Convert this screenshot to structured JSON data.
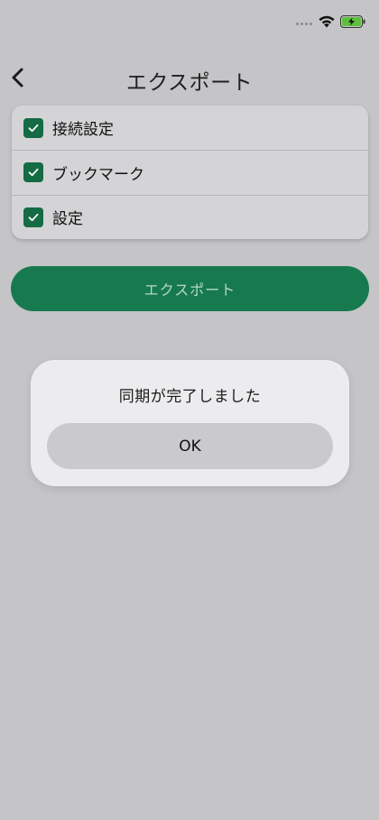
{
  "status_bar": {
    "signal_icon": "cellular-dots-icon",
    "wifi_icon": "wifi-icon",
    "battery_icon": "battery-charging-icon",
    "battery_accent": "#5ec03c"
  },
  "header": {
    "back_icon": "chevron-left-icon",
    "title": "エクスポート"
  },
  "options": [
    {
      "label": "接続設定",
      "checked": true
    },
    {
      "label": "ブックマーク",
      "checked": true
    },
    {
      "label": "設定",
      "checked": true
    }
  ],
  "export_button": {
    "label": "エクスポート"
  },
  "dialog": {
    "message": "同期が完了しました",
    "ok_label": "OK"
  },
  "colors": {
    "accent": "#177a4e",
    "checkbox": "#156b43",
    "background": "#c5c5c8"
  }
}
